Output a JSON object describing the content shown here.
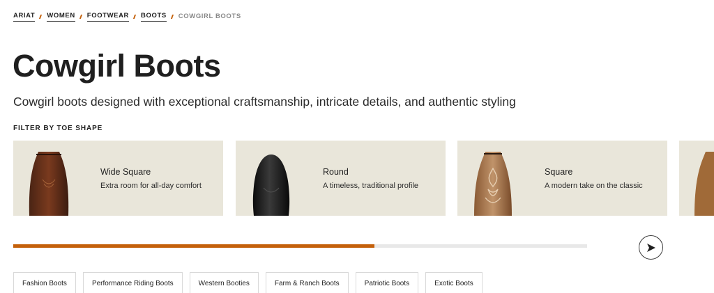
{
  "breadcrumb": {
    "items": [
      {
        "label": "ARIAT"
      },
      {
        "label": "WOMEN"
      },
      {
        "label": "FOOTWEAR"
      },
      {
        "label": "BOOTS"
      }
    ],
    "current": "COWGIRL BOOTS"
  },
  "page": {
    "title": "Cowgirl Boots",
    "subtitle": "Cowgirl boots designed with exceptional craftsmanship, intricate details, and authentic styling"
  },
  "filter": {
    "label": "FILTER BY TOE SHAPE",
    "cards": [
      {
        "title": "Wide Square",
        "desc": "Extra room for all-day comfort",
        "icon": "wide-square-boot-icon"
      },
      {
        "title": "Round",
        "desc": "A timeless, traditional profile",
        "icon": "round-toe-boot-icon"
      },
      {
        "title": "Square",
        "desc": "A modern take on the classic",
        "icon": "square-toe-boot-icon"
      }
    ]
  },
  "carousel": {
    "progress_percent": 63,
    "next_icon": "arrow-right-icon"
  },
  "categories": [
    {
      "label": "Fashion Boots"
    },
    {
      "label": "Performance Riding Boots"
    },
    {
      "label": "Western Booties"
    },
    {
      "label": "Farm & Ranch Boots"
    },
    {
      "label": "Patriotic Boots"
    },
    {
      "label": "Exotic Boots"
    }
  ],
  "colors": {
    "accent": "#c4600a",
    "card_bg": "#e9e6da",
    "text": "#1f1f1f"
  }
}
